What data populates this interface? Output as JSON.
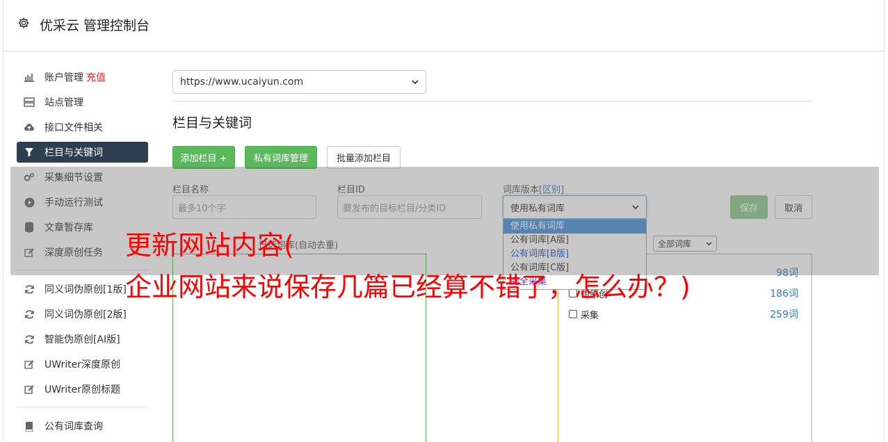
{
  "header": {
    "title": "优采云 管理控制台",
    "icon": "gear-icon"
  },
  "sidebar": {
    "items": [
      {
        "label": "账户管理",
        "badge": "充值",
        "icon": "bar-chart-icon"
      },
      {
        "label": "站点管理",
        "icon": "server-icon"
      },
      {
        "label": "接口文件相关",
        "icon": "cloud-upload-icon"
      },
      {
        "label": "栏目与关键词",
        "icon": "filter-icon",
        "active": true
      },
      {
        "label": "采集细节设置",
        "icon": "cogs-icon"
      },
      {
        "label": "手动运行测试",
        "icon": "play-circle-icon"
      },
      {
        "label": "文章暂存库",
        "icon": "database-icon"
      },
      {
        "label": "深度原创任务",
        "icon": "edit-icon"
      },
      {
        "label": "同义词伪原创[1版]",
        "icon": "refresh-icon"
      },
      {
        "label": "同义词伪原创[2版]",
        "icon": "refresh-icon"
      },
      {
        "label": "智能伪原创[AI版]",
        "icon": "refresh-icon"
      },
      {
        "label": "UWriter深度原创",
        "icon": "edit-icon"
      },
      {
        "label": "UWriter原创标题",
        "icon": "edit-icon"
      },
      {
        "label": "公有词库查询",
        "icon": "book-icon"
      }
    ]
  },
  "main": {
    "site_select": "https://www.ucaiyun.com",
    "section_title": "栏目与关键词",
    "buttons": {
      "add_column": "添加栏目 +",
      "private_lib": "私有词库管理",
      "batch_add": "批量添加栏目"
    },
    "form": {
      "name_label": "栏目名称",
      "name_placeholder": "最多10个字",
      "id_label": "栏目ID",
      "id_placeholder": "要发布的目标栏目/分类ID",
      "lib_label": "词库版本",
      "lib_label_link": "[区别]",
      "lib_value": "使用私有词库",
      "save": "保存",
      "cancel": "取消"
    },
    "dropdown_options": [
      "使用私有词库",
      "公有词库[A版]",
      "公有词库[B版]",
      "公有词库[C版]",
      "完全采集"
    ],
    "panel_caption": "已选词库(自动去重)",
    "filter_value": "全部词库",
    "libraries": [
      {
        "name": "",
        "count": "98词"
      },
      {
        "name": "伪原创",
        "count": "186词"
      },
      {
        "name": "采集",
        "count": "259词"
      }
    ]
  },
  "overlay": {
    "line1": "更新网站内容(",
    "line2": "企业网站来说保存几篇已经算不错了，怎么办？)"
  }
}
